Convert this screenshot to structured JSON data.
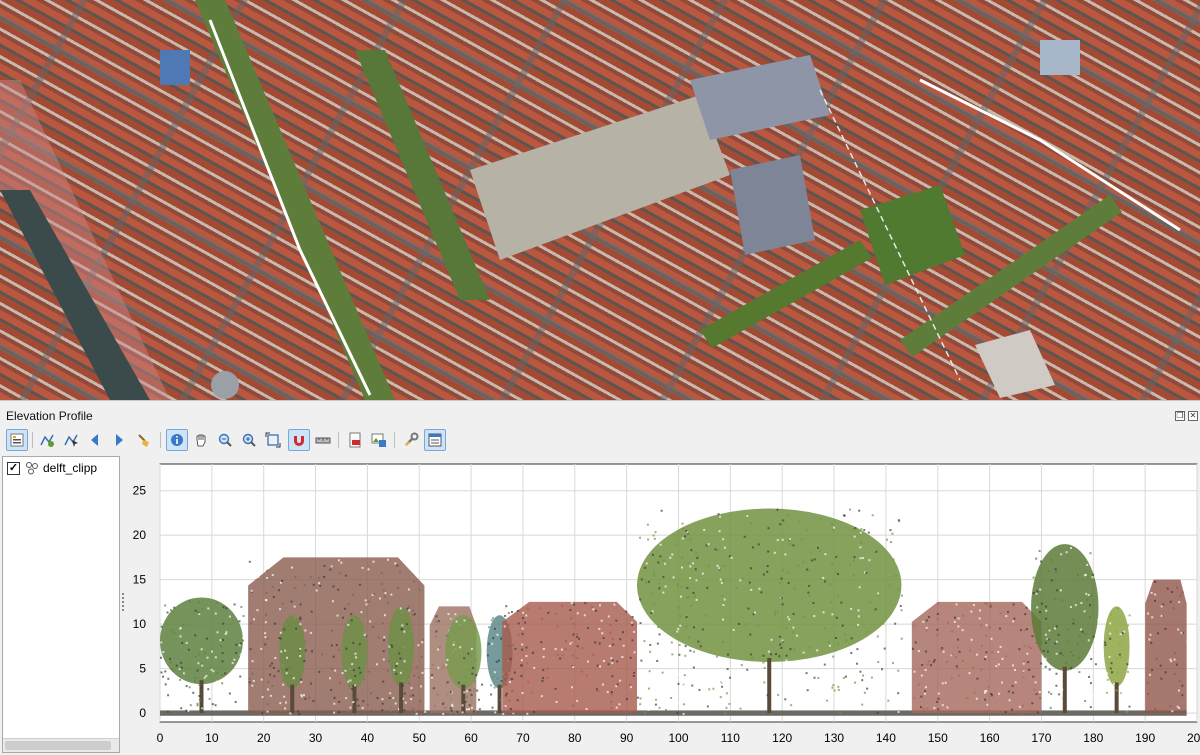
{
  "map": {
    "description_icon": "aerial-imagery-map",
    "colors": {
      "roof": "#b9573f",
      "tree": "#5e7d3a",
      "square": "#b6b2a6",
      "canal": "#3d4a4c",
      "road": "#6f6f6f"
    }
  },
  "panel": {
    "title": "Elevation Profile",
    "controls": {
      "float_label": "❐",
      "close_label": "✕"
    }
  },
  "toolbar": {
    "buttons": [
      {
        "name": "layer-tree-toggle-icon",
        "active": true
      },
      {
        "name": "capture-curve-icon",
        "active": false
      },
      {
        "name": "capture-curve-from-feature-icon",
        "active": false
      },
      {
        "name": "nudge-left-icon",
        "active": false
      },
      {
        "name": "nudge-right-icon",
        "active": false
      },
      {
        "name": "clear-curve-icon",
        "active": false
      },
      {
        "name": "identify-icon",
        "active": true
      },
      {
        "name": "pan-icon",
        "active": false
      },
      {
        "name": "zoom-x-icon",
        "active": false
      },
      {
        "name": "zoom-icon",
        "active": false
      },
      {
        "name": "zoom-full-icon",
        "active": false
      },
      {
        "name": "snapping-icon",
        "active": true
      },
      {
        "name": "measure-distance-icon",
        "active": false
      },
      {
        "name": "export-pdf-icon",
        "active": false
      },
      {
        "name": "export-image-icon",
        "active": false
      },
      {
        "name": "settings-wrench-icon",
        "active": false
      },
      {
        "name": "options-panel-icon",
        "active": true
      }
    ]
  },
  "layer_tree": {
    "layers": [
      {
        "name": "delft_clipp",
        "checked": true,
        "check_glyph": "✓"
      }
    ]
  },
  "chart_data": {
    "type": "scatter",
    "title": "",
    "xlabel": "",
    "ylabel": "",
    "xlim": [
      0,
      200
    ],
    "ylim": [
      -1,
      28
    ],
    "x_ticks": [
      "0",
      "10",
      "20",
      "30",
      "40",
      "50",
      "60",
      "70",
      "80",
      "90",
      "100",
      "110",
      "120",
      "130",
      "140",
      "150",
      "160",
      "170",
      "180",
      "190",
      "200"
    ],
    "y_ticks": [
      "0",
      "5",
      "10",
      "15",
      "20",
      "25"
    ],
    "grid": true,
    "features": [
      {
        "kind": "tree",
        "x": [
          0,
          16
        ],
        "height": 13,
        "color": "#5f8040"
      },
      {
        "kind": "building",
        "x": [
          17,
          51
        ],
        "height": 17.5,
        "color": "#8a5b4e"
      },
      {
        "kind": "tree",
        "x": [
          23,
          28
        ],
        "height": 11,
        "color": "#6c8c45"
      },
      {
        "kind": "tree",
        "x": [
          35,
          40
        ],
        "height": 11,
        "color": "#6f9048"
      },
      {
        "kind": "tree",
        "x": [
          44,
          49
        ],
        "height": 12,
        "color": "#6f9048"
      },
      {
        "kind": "building",
        "x": [
          52,
          61
        ],
        "height": 12,
        "color": "#9b7062"
      },
      {
        "kind": "tree",
        "x": [
          55,
          62
        ],
        "height": 11,
        "color": "#7a9a50"
      },
      {
        "kind": "tree",
        "x": [
          63,
          68
        ],
        "height": 11,
        "color": "#5f8a8a"
      },
      {
        "kind": "building",
        "x": [
          66,
          92
        ],
        "height": 12.5,
        "color": "#a65a4b"
      },
      {
        "kind": "tree",
        "x": [
          92,
          143
        ],
        "height": 23,
        "color": "#72923f"
      },
      {
        "kind": "building",
        "x": [
          145,
          170
        ],
        "height": 12.5,
        "color": "#a4665a"
      },
      {
        "kind": "tree",
        "x": [
          168,
          181
        ],
        "height": 19,
        "color": "#5c7a38"
      },
      {
        "kind": "tree",
        "x": [
          182,
          187
        ],
        "height": 12,
        "color": "#8ea544"
      },
      {
        "kind": "building",
        "x": [
          190,
          198
        ],
        "height": 15,
        "color": "#8e5548"
      }
    ]
  }
}
